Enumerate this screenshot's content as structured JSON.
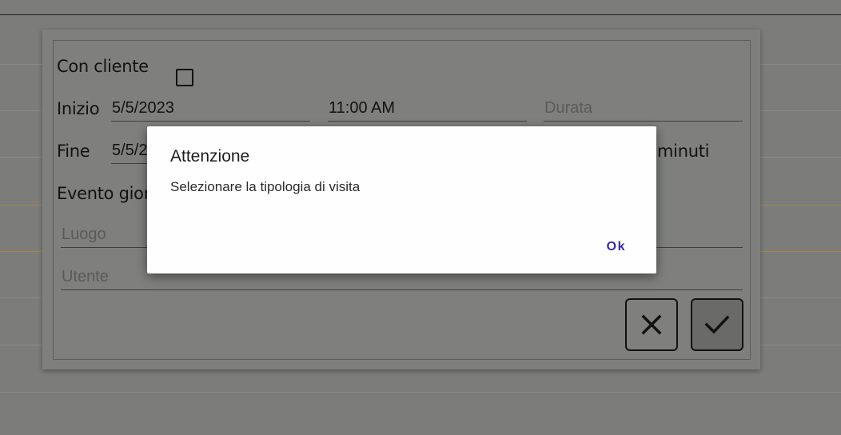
{
  "form": {
    "con_cliente_label": "Con cliente",
    "inizio_label": "Inizio",
    "inizio_date": "5/5/2023",
    "inizio_time": "11:00 AM",
    "durata_placeholder": "Durata",
    "fine_label": "Fine",
    "fine_date": "5/5/2",
    "minuti_label": "minuti",
    "evento_label": "Evento gior",
    "luogo_placeholder": "Luogo",
    "utente_placeholder": "Utente",
    "cancel_icon": "close-icon",
    "confirm_icon": "check-icon"
  },
  "dialog": {
    "title": "Attenzione",
    "message": "Selezionare la tipologia di visita",
    "ok_label": "Ok",
    "ok_color": "#3d2a9c"
  }
}
